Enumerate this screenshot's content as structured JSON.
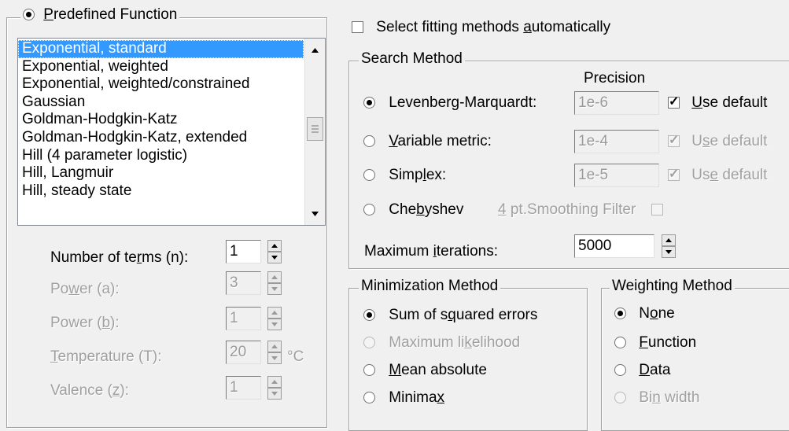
{
  "predefined": {
    "label_pre": "",
    "label_u": "P",
    "label_post": "redefined Function",
    "selected": true,
    "list": [
      {
        "text": "Exponential, standard",
        "selected": true
      },
      {
        "text": "Exponential, weighted",
        "selected": false
      },
      {
        "text": "Exponential, weighted/constrained",
        "selected": false
      },
      {
        "text": "Gaussian",
        "selected": false
      },
      {
        "text": "Goldman-Hodgkin-Katz",
        "selected": false
      },
      {
        "text": "Goldman-Hodgkin-Katz, extended",
        "selected": false
      },
      {
        "text": "Hill (4 parameter logistic)",
        "selected": false
      },
      {
        "text": "Hill, Langmuir",
        "selected": false
      },
      {
        "text": "Hill, steady state",
        "selected": false
      }
    ],
    "params": {
      "terms": {
        "pre": "Number of te",
        "u": "r",
        "post": "ms (n):",
        "value": "1",
        "enabled": true
      },
      "power_a": {
        "pre": "Po",
        "u": "w",
        "post": "er (a):",
        "value": "3",
        "enabled": false
      },
      "power_b": {
        "pre": "Power (",
        "u": "b",
        "post": "):",
        "value": "1",
        "enabled": false
      },
      "temperature": {
        "pre": "",
        "u": "T",
        "post": "emperature (T):",
        "value": "20",
        "unit": "°C",
        "enabled": false
      },
      "valence": {
        "pre": "Valence (",
        "u": "z",
        "post": "):",
        "value": "1",
        "enabled": false
      }
    }
  },
  "auto_select": {
    "pre": "Select fitting methods ",
    "u": "a",
    "post": "utomatically",
    "checked": false
  },
  "search": {
    "title": "Search Method",
    "precision_header": "Precision",
    "methods": [
      {
        "pre": "Levenberg-Marquardt:",
        "u": "",
        "post": "",
        "selected": true,
        "precision": "1e-6",
        "default_pre": "",
        "default_u": "U",
        "default_post": "se default",
        "default_checked": true,
        "default_enabled": true
      },
      {
        "pre": "",
        "u": "V",
        "post": "ariable metric:",
        "selected": false,
        "precision": "1e-4",
        "default_pre": "U",
        "default_u": "s",
        "default_post": "e default",
        "default_checked": true,
        "default_enabled": false
      },
      {
        "pre": "Simp",
        "u": "l",
        "post": "ex:",
        "selected": false,
        "precision": "1e-5",
        "default_pre": "Us",
        "default_u": "e",
        "default_post": " default",
        "default_checked": true,
        "default_enabled": false
      }
    ],
    "chebyshev": {
      "pre": "Che",
      "u": "b",
      "post": "yshev",
      "selected": false,
      "filter_u": "4",
      "filter_post": " pt.Smoothing Filter",
      "filter_checked": false
    },
    "max_iter": {
      "pre": "Maximum ",
      "u": "i",
      "post": "terations:",
      "value": "5000"
    }
  },
  "minimization": {
    "title": "Minimization Method",
    "options": [
      {
        "pre": "Sum of s",
        "u": "q",
        "post": "uared errors",
        "selected": true,
        "enabled": true
      },
      {
        "pre": "Maximum li",
        "u": "k",
        "post": "elihood",
        "selected": false,
        "enabled": false
      },
      {
        "pre": "",
        "u": "M",
        "post": "ean absolute",
        "selected": false,
        "enabled": true
      },
      {
        "pre": "Minima",
        "u": "x",
        "post": "",
        "selected": false,
        "enabled": true
      }
    ]
  },
  "weighting": {
    "title": "Weighting Method",
    "options": [
      {
        "pre": "N",
        "u": "o",
        "post": "ne",
        "selected": true,
        "enabled": true
      },
      {
        "pre": "",
        "u": "F",
        "post": "unction",
        "selected": false,
        "enabled": true
      },
      {
        "pre": "",
        "u": "D",
        "post": "ata",
        "selected": false,
        "enabled": true
      },
      {
        "pre": "Bi",
        "u": "n",
        "post": " width",
        "selected": false,
        "enabled": false
      }
    ]
  }
}
